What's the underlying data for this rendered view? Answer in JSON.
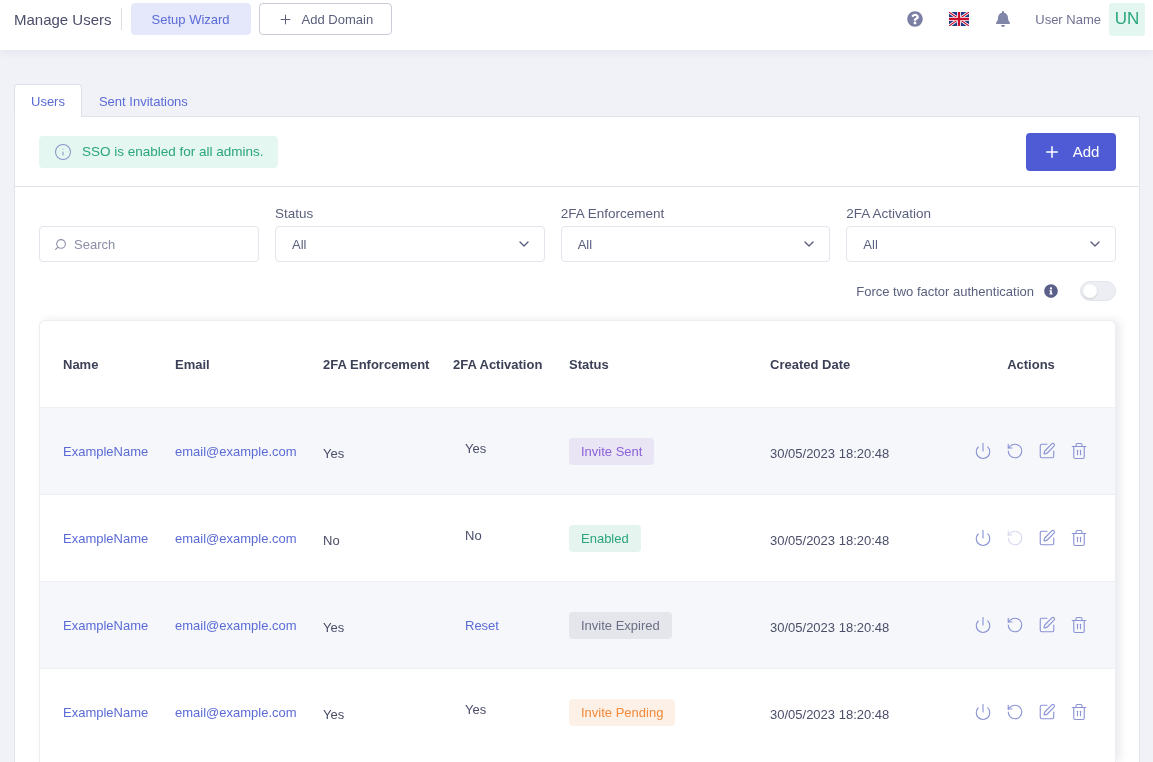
{
  "header": {
    "title": "Manage Users",
    "buttons": [
      {
        "label": "Setup Wizard",
        "kind": "soft"
      },
      {
        "label": "Add Domain",
        "kind": "outline"
      }
    ],
    "user_name": "User Name",
    "avatar_initials": "UN"
  },
  "tabs": [
    {
      "label": "Users",
      "selected": true
    },
    {
      "label": "Sent Invitations",
      "selected": false
    }
  ],
  "alert": {
    "text": "SSO is enabled for all admins."
  },
  "add_button": {
    "label": "Add"
  },
  "filters": {
    "search": {
      "placeholder": "Search"
    },
    "selects": [
      {
        "label": "Status",
        "value": "All"
      },
      {
        "label": "2FA Enforcement",
        "value": "All"
      },
      {
        "label": "2FA Activation",
        "value": "All"
      }
    ]
  },
  "force_2fa": {
    "label": "Force two factor authentication",
    "on": false
  },
  "table": {
    "columns": [
      "Name",
      "Email",
      "2FA Enforcement",
      "2FA Activation",
      "Status",
      "Created Date",
      "Actions"
    ],
    "rows": [
      {
        "name": "ExampleName",
        "email": "email@example.com",
        "enforcement": "Yes",
        "activation": {
          "text": "Yes",
          "kind": "text"
        },
        "status": {
          "label": "Invite Sent",
          "color": "#8b62d9"
        },
        "created": "30/05/2023 18:20:48",
        "actions": [
          {
            "kind": "power",
            "disabled": false
          },
          {
            "kind": "reset",
            "disabled": false
          },
          {
            "kind": "edit",
            "disabled": false
          },
          {
            "kind": "delete",
            "disabled": false
          }
        ]
      },
      {
        "name": "ExampleName",
        "email": "email@example.com",
        "enforcement": "No",
        "activation": {
          "text": "No",
          "kind": "text"
        },
        "status": {
          "label": "Enabled",
          "color": "#2aa57d"
        },
        "created": "30/05/2023 18:20:48",
        "actions": [
          {
            "kind": "power",
            "disabled": false
          },
          {
            "kind": "reset",
            "disabled": true
          },
          {
            "kind": "edit",
            "disabled": false
          },
          {
            "kind": "delete",
            "disabled": false
          }
        ]
      },
      {
        "name": "ExampleName",
        "email": "email@example.com",
        "enforcement": "Yes",
        "activation": {
          "text": "Reset",
          "kind": "link"
        },
        "status": {
          "label": "Invite Expired",
          "color": "#6b6f85"
        },
        "created": "30/05/2023 18:20:48",
        "actions": [
          {
            "kind": "power",
            "disabled": false
          },
          {
            "kind": "reset",
            "disabled": false
          },
          {
            "kind": "edit",
            "disabled": false
          },
          {
            "kind": "delete",
            "disabled": false
          }
        ]
      },
      {
        "name": "ExampleName",
        "email": "email@example.com",
        "enforcement": "Yes",
        "activation": {
          "text": "Yes",
          "kind": "text"
        },
        "status": {
          "label": "Invite Pending",
          "color": "#f08a3c"
        },
        "created": "30/05/2023 18:20:48",
        "actions": [
          {
            "kind": "power",
            "disabled": false
          },
          {
            "kind": "reset",
            "disabled": false
          },
          {
            "kind": "edit",
            "disabled": false
          },
          {
            "kind": "delete",
            "disabled": false
          }
        ]
      }
    ]
  }
}
